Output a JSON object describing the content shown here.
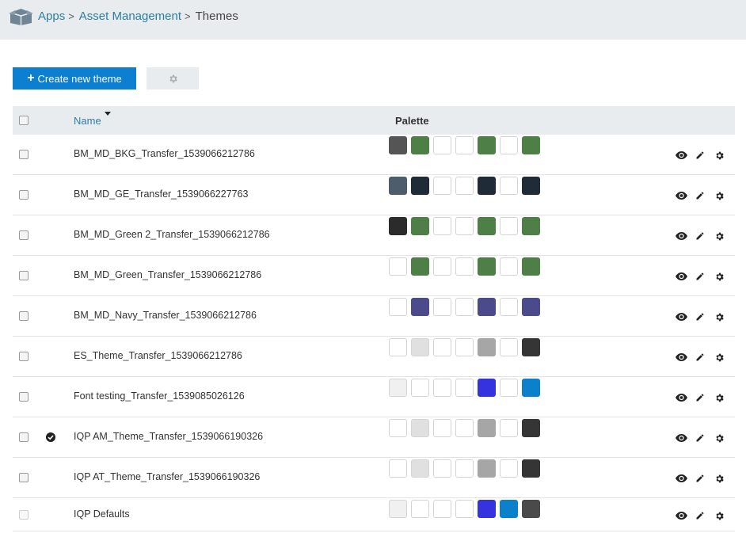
{
  "header": {
    "logo_icon": "box-icon",
    "breadcrumb": [
      {
        "label": "Apps",
        "link": true
      },
      {
        "label": "Asset Management",
        "link": true
      },
      {
        "label": "Themes",
        "link": false
      }
    ],
    "separator": ">"
  },
  "toolbar": {
    "create_label": "Create new theme",
    "create_icon": "plus-icon",
    "settings_icon": "gear-icon"
  },
  "table": {
    "columns": {
      "name": "Name",
      "palette": "Palette"
    },
    "sort": {
      "column": "Name",
      "direction": "descending"
    },
    "rows": [
      {
        "name": "BM_MD_BKG_Transfer_1539066212786",
        "active": false,
        "disabled": false,
        "palette": [
          "#555555",
          "#4e7f47",
          "#ffffff",
          "#ffffff",
          "#4e7f47",
          "#ffffff",
          "#4e7f47"
        ]
      },
      {
        "name": "BM_MD_GE_Transfer_1539066227763",
        "active": false,
        "disabled": false,
        "palette": [
          "#4d5d6b",
          "#1f2c37",
          "#ffffff",
          "#ffffff",
          "#1f2c37",
          "#ffffff",
          "#1f2c37"
        ]
      },
      {
        "name": "BM_MD_Green 2_Transfer_1539066212786",
        "active": false,
        "disabled": false,
        "palette": [
          "#2b2b2b",
          "#4e7f47",
          "#ffffff",
          "#ffffff",
          "#4e7f47",
          "#ffffff",
          "#4e7f47"
        ]
      },
      {
        "name": "BM_MD_Green_Transfer_1539066212786",
        "active": false,
        "disabled": false,
        "palette": [
          "#ffffff",
          "#4e7f47",
          "#ffffff",
          "#ffffff",
          "#4e7f47",
          "#ffffff",
          "#4e7f47"
        ]
      },
      {
        "name": "BM_MD_Navy_Transfer_1539066212786",
        "active": false,
        "disabled": false,
        "palette": [
          "#ffffff",
          "#4b4a8a",
          "#ffffff",
          "#ffffff",
          "#4b4a8a",
          "#ffffff",
          "#4b4a8a"
        ]
      },
      {
        "name": "ES_Theme_Transfer_1539066212786",
        "active": false,
        "disabled": false,
        "palette": [
          "#ffffff",
          "#e0e0e0",
          "#ffffff",
          "#ffffff",
          "#a6a6a6",
          "#ffffff",
          "#353535"
        ]
      },
      {
        "name": "Font testing_Transfer_1539085026126",
        "active": false,
        "disabled": false,
        "palette": [
          "#f0f0f0",
          "#ffffff",
          "#ffffff",
          "#ffffff",
          "#3532e0",
          "#ffffff",
          "#0b81cc"
        ]
      },
      {
        "name": "IQP AM_Theme_Transfer_1539066190326",
        "active": true,
        "disabled": false,
        "palette": [
          "#ffffff",
          "#e0e0e0",
          "#ffffff",
          "#ffffff",
          "#a6a6a6",
          "#ffffff",
          "#353535"
        ]
      },
      {
        "name": "IQP AT_Theme_Transfer_1539066190326",
        "active": false,
        "disabled": false,
        "palette": [
          "#ffffff",
          "#e0e0e0",
          "#ffffff",
          "#ffffff",
          "#a6a6a6",
          "#ffffff",
          "#353535"
        ]
      },
      {
        "name": "IQP Defaults",
        "active": false,
        "disabled": true,
        "palette": [
          "#f0f0f0",
          "#ffffff",
          "#ffffff",
          "#ffffff",
          "#3532e0",
          "#0b81cc",
          "#4a4a4a"
        ]
      }
    ],
    "row_actions": [
      "eye-icon",
      "pencil-icon",
      "gear-icon"
    ]
  }
}
